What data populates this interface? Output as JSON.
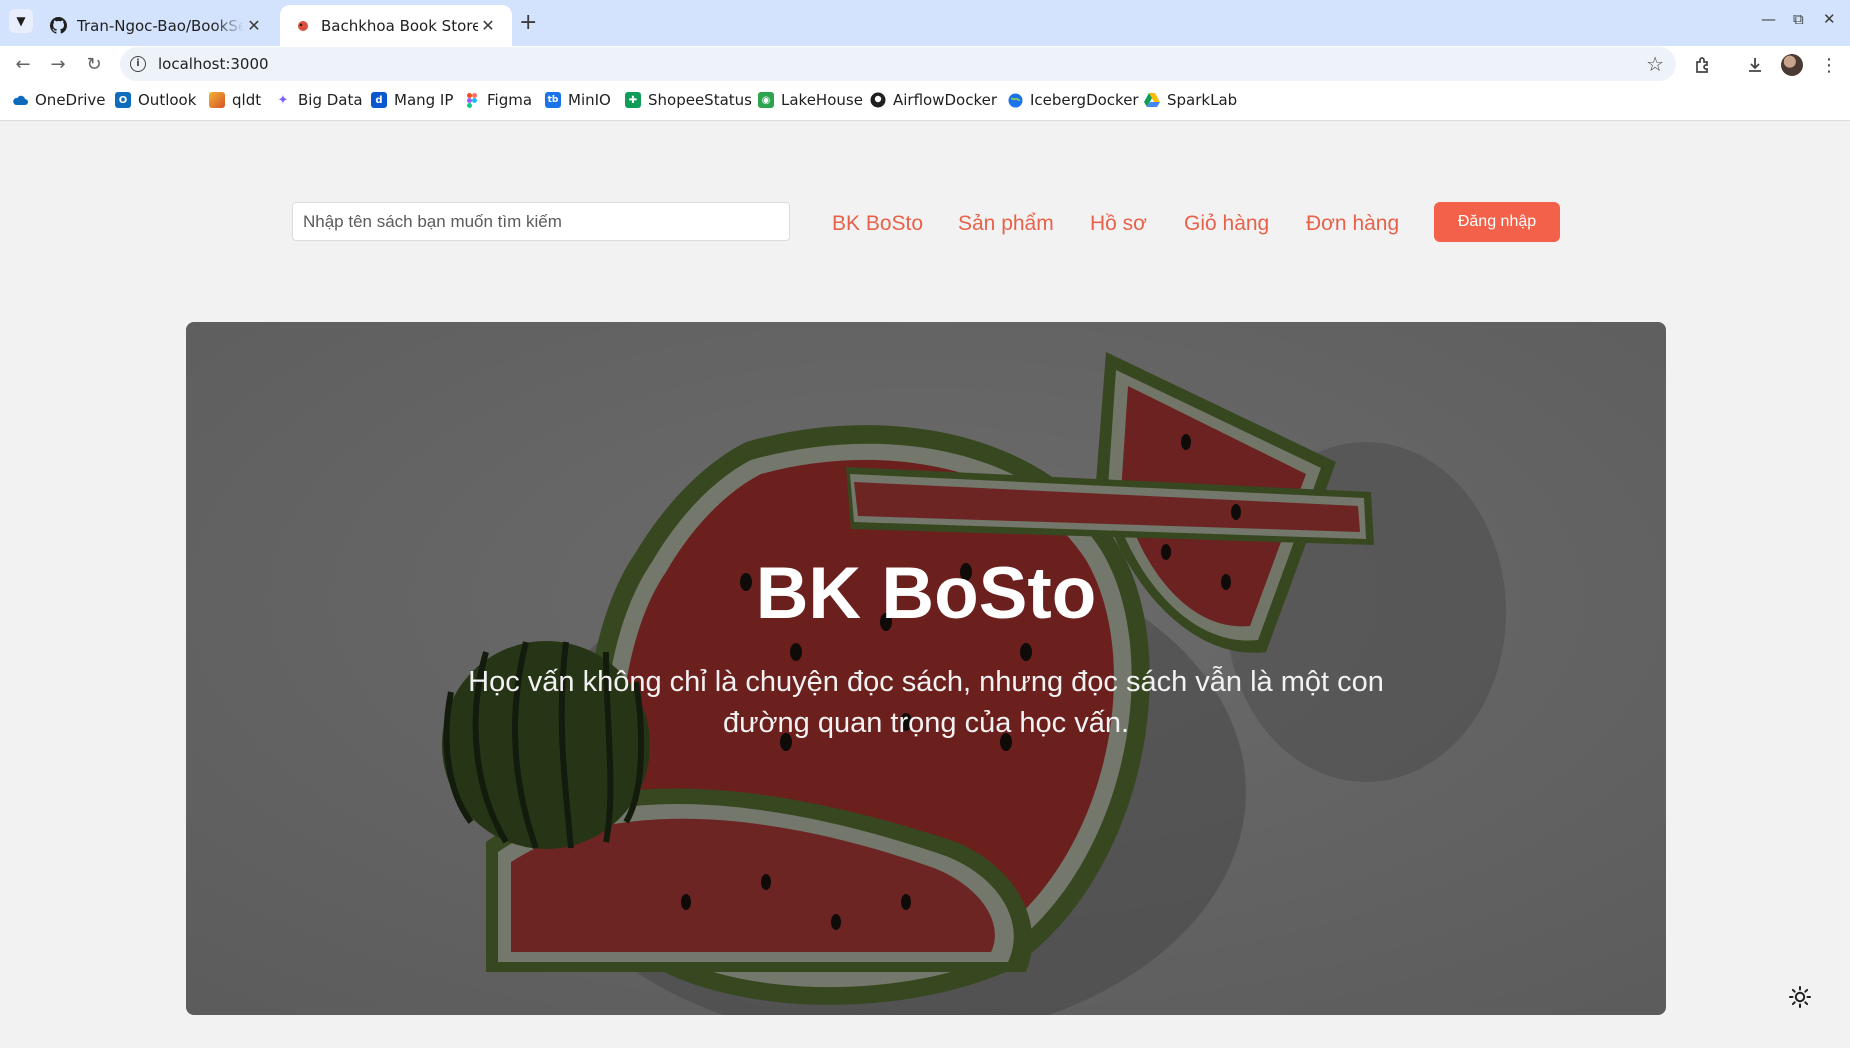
{
  "browser": {
    "tabs": [
      {
        "title": "Tran-Ngoc-Bao/BookSell",
        "icon": "github-icon",
        "active": false
      },
      {
        "title": "Bachkhoa Book Store",
        "icon": "site-favicon",
        "active": true
      }
    ],
    "url": "localhost:3000",
    "bookmarks": [
      {
        "label": "OneDrive",
        "icon": "onedrive-icon",
        "color": "#0f6cbd"
      },
      {
        "label": "Outlook",
        "icon": "outlook-icon",
        "color": "#0f6cbd"
      },
      {
        "label": "qldt",
        "icon": "qldt-icon",
        "color": "#d9502b"
      },
      {
        "label": "Big Data",
        "icon": "sparkle-icon",
        "color": "#7b61ff"
      },
      {
        "label": "Mang IP",
        "icon": "d-icon",
        "color": "#0b57d0"
      },
      {
        "label": "Figma",
        "icon": "figma-icon",
        "color": "#f24e1e"
      },
      {
        "label": "MinIO",
        "icon": "tb-icon",
        "color": "#1a73e8"
      },
      {
        "label": "ShopeeStatus",
        "icon": "sheets-icon",
        "color": "#0f9d58"
      },
      {
        "label": "LakeHouse",
        "icon": "lakehouse-icon",
        "color": "#2da44e"
      },
      {
        "label": "AirflowDocker",
        "icon": "github-icon",
        "color": "#1f1f1f"
      },
      {
        "label": "IcebergDocker",
        "icon": "globe-icon",
        "color": "#1a73e8"
      },
      {
        "label": "SparkLab",
        "icon": "drive-icon",
        "color": "#fbbc04"
      }
    ]
  },
  "header": {
    "search_placeholder": "Nhập tên sách bạn muốn tìm kiếm",
    "nav": [
      "BK BoSto",
      "Sản phẩm",
      "Hồ sơ",
      "Giỏ hàng",
      "Đơn hàng"
    ],
    "login_label": "Đăng nhập"
  },
  "hero": {
    "title": "BK BoSto",
    "quote": "Học vấn không chỉ là chuyện đọc sách, nhưng đọc sách vẫn là một con đường quan trọng của học vấn."
  },
  "colors": {
    "accent": "#f4614a",
    "nav_text": "#e8624b",
    "page_bg": "#f2f2f2"
  }
}
